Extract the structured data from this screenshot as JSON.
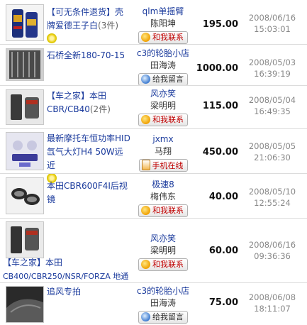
{
  "items": [
    {
      "title_line1": "【可无条件退货】壳",
      "title_line2": "牌爱德王子白",
      "count": "(3件)",
      "shop": "qlm单摇臂",
      "person": "陈阳坤",
      "button": "和我联系",
      "price": "195.00",
      "date": "2008/06/16",
      "time": "15:03:01"
    },
    {
      "title_line1": "石桥全新180-70-15",
      "title_line2": "",
      "count": "",
      "shop": "c3的轮胎小店",
      "person": "田海涛",
      "button": "给我留言",
      "price": "1000.00",
      "date": "2008/05/03",
      "time": "16:39:19"
    },
    {
      "title_line1": "【车之家】本田",
      "title_line2": "CBR/CB40",
      "count": "(2件)",
      "shop": "风亦笑",
      "person": "梁明明",
      "button": "和我联系",
      "price": "115.00",
      "date": "2008/05/04",
      "time": "16:49:35"
    },
    {
      "title_line1": "最新摩托车恒功率HID",
      "title_line2": "氙气大灯H4 50W远近",
      "count": "",
      "shop": "jxmx",
      "person": "马翔",
      "button": "手机在线",
      "price": "450.00",
      "date": "2008/05/05",
      "time": "21:06:30"
    },
    {
      "title_line1": "本田CBR600F4I后视",
      "title_line2": "镜",
      "count": "",
      "shop": "极速8",
      "person": "梅伟东",
      "button": "和我联系",
      "price": "40.00",
      "date": "2008/05/10",
      "time": "12:55:24"
    },
    {
      "title_line1": "【车之家】本田",
      "title_line2": "CB400/CBR250/NSR/FORZA 地通",
      "count": "",
      "shop": "风亦笑",
      "person": "梁明明",
      "button": "和我联系",
      "price": "60.00",
      "date": "2008/06/16",
      "time": "09:36:36"
    },
    {
      "title_line1": "追风专拍",
      "title_line2": "",
      "count": "",
      "shop": "c3的轮胎小店",
      "person": "田海涛",
      "button": "给我留言",
      "price": "75.00",
      "date": "2008/06/08",
      "time": "18:11:07"
    }
  ],
  "icons": {
    "contact": "speech-bubble-icon",
    "message": "speech-bubble-icon",
    "mobile": "mobile-phone-icon",
    "badge": "flower-badge-icon"
  }
}
